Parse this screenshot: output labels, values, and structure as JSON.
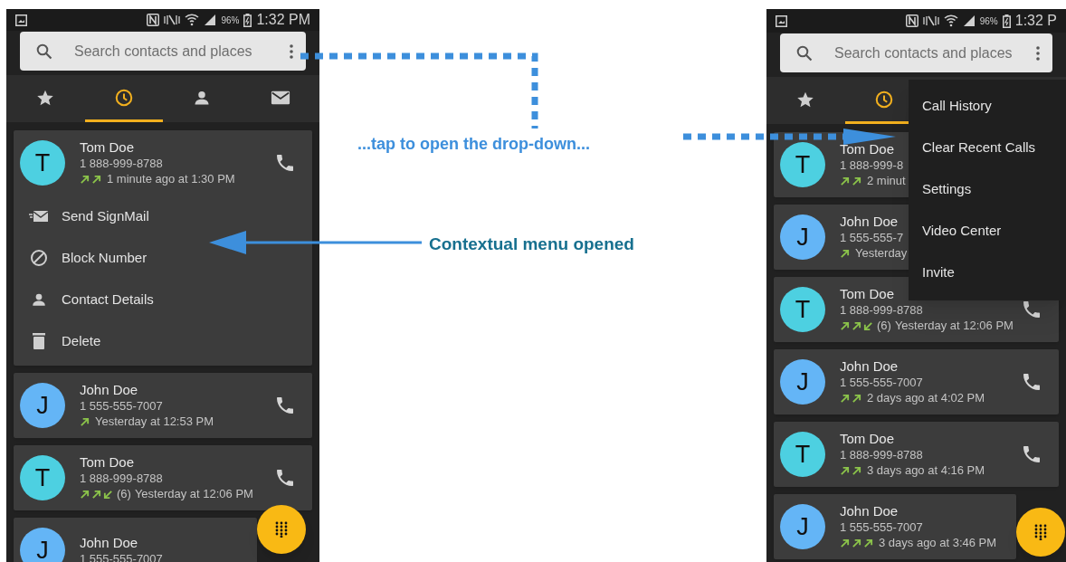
{
  "phones": [
    {
      "status": {
        "battery": "96%",
        "time": "1:32 PM"
      },
      "search": {
        "placeholder": "Search contacts and places"
      },
      "tabs": [
        {
          "kind": "star",
          "selected": false
        },
        {
          "kind": "clock",
          "selected": true
        },
        {
          "kind": "person",
          "selected": false
        },
        {
          "kind": "mail",
          "selected": false
        }
      ],
      "calls": [
        {
          "initial": "T",
          "color": "#4dd0e1",
          "name": "Tom Doe",
          "number": "1 888-999-8788",
          "directions": [
            {
              "kind": "out"
            },
            {
              "kind": "out"
            }
          ],
          "when": "1 minute ago at 1:30 PM",
          "actions": [
            {
              "kind": "signmail",
              "label": "Send SignMail"
            },
            {
              "kind": "block",
              "label": "Block Number"
            },
            {
              "kind": "contact",
              "label": "Contact Details"
            },
            {
              "kind": "delete",
              "label": "Delete"
            }
          ]
        },
        {
          "initial": "J",
          "color": "#64b5f6",
          "name": "John Doe",
          "number": "1 555-555-7007",
          "directions": [
            {
              "kind": "out"
            }
          ],
          "when": "Yesterday at 12:53 PM"
        },
        {
          "initial": "T",
          "color": "#4dd0e1",
          "name": "Tom Doe",
          "number": "1 888-999-8788",
          "directions": [
            {
              "kind": "out"
            },
            {
              "kind": "out"
            },
            {
              "kind": "in"
            }
          ],
          "count": "(6)",
          "when": "Yesterday at 12:06 PM"
        },
        {
          "initial": "J",
          "color": "#64b5f6",
          "name": "John Doe",
          "number": "1 555-555-7007"
        }
      ]
    },
    {
      "status": {
        "battery": "96%",
        "time": "1:32 P"
      },
      "search": {
        "placeholder": "Search contacts and places"
      },
      "tabs": [
        {
          "kind": "star",
          "selected": false
        },
        {
          "kind": "clock",
          "selected": true
        }
      ],
      "calls": [
        {
          "initial": "T",
          "color": "#4dd0e1",
          "name": "Tom Doe",
          "number": "1 888-999-8",
          "directions": [
            {
              "kind": "out"
            },
            {
              "kind": "out"
            }
          ],
          "when": "2 minut"
        },
        {
          "initial": "J",
          "color": "#64b5f6",
          "name": "John Doe",
          "number": "1 555-555-7",
          "directions": [
            {
              "kind": "out"
            }
          ],
          "when": "Yesterday"
        },
        {
          "initial": "T",
          "color": "#4dd0e1",
          "name": "Tom Doe",
          "number": "1 888-999-8788",
          "directions": [
            {
              "kind": "out"
            },
            {
              "kind": "out"
            },
            {
              "kind": "in"
            }
          ],
          "count": "(6)",
          "when": "Yesterday at 12:06 PM"
        },
        {
          "initial": "J",
          "color": "#64b5f6",
          "name": "John Doe",
          "number": "1 555-555-7007",
          "directions": [
            {
              "kind": "out"
            },
            {
              "kind": "out"
            }
          ],
          "when": "2 days ago at 4:02 PM"
        },
        {
          "initial": "T",
          "color": "#4dd0e1",
          "name": "Tom Doe",
          "number": "1 888-999-8788",
          "directions": [
            {
              "kind": "out"
            },
            {
              "kind": "out"
            }
          ],
          "when": "3 days ago at 4:16 PM"
        },
        {
          "initial": "J",
          "color": "#64b5f6",
          "name": "John Doe",
          "number": "1 555-555-7007",
          "directions": [
            {
              "kind": "out"
            },
            {
              "kind": "out"
            },
            {
              "kind": "out"
            }
          ],
          "when": "3 days ago at 3:46 PM"
        }
      ],
      "menu": {
        "items": [
          "Call History",
          "Clear Recent Calls",
          "Settings",
          "Video Center",
          "Invite"
        ]
      }
    }
  ],
  "annotations": {
    "dropdown": "...tap to open the drop-down...",
    "contextual": "Contextual menu opened"
  }
}
